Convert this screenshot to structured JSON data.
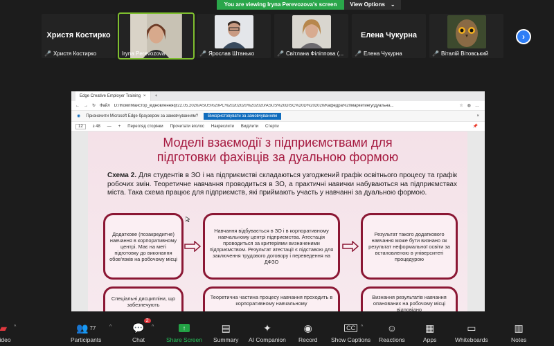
{
  "banner": {
    "message": "You are viewing Iryna Perevozova's screen",
    "options_label": "View Options",
    "options_caret": "⌄"
  },
  "gallery": [
    {
      "name_big": "Христя Костирко",
      "name": "Христя Костирко",
      "muted": true,
      "video": false
    },
    {
      "name_big": "",
      "name": "Iryna Perevozova",
      "muted": false,
      "video": true,
      "active": true
    },
    {
      "name_big": "",
      "name": "Ярослав Штанько",
      "muted": true,
      "video": true
    },
    {
      "name_big": "",
      "name": "Світлана Філіппова (...",
      "muted": true,
      "video": true
    },
    {
      "name_big": "Елена Чукурна",
      "name": "Елена Чукурна",
      "muted": true,
      "video": false
    },
    {
      "name_big": "",
      "name": "Віталій Вітовський",
      "muted": true,
      "video": true
    }
  ],
  "browser": {
    "tab_title": "Edge Creative Employer Training",
    "tab_close": "×",
    "new_tab": "+",
    "file_label": "Файл",
    "url": "D:/ІКомпМайстор_відновлення@22.05.2020/ASUS%20PC%20202020%202020/ASUS%20DISC%20D%202020/Кафедра%20маркетингу/Дуальна...",
    "notif_text": "Призначити Microsoft Edge браузером за замовчуванням?",
    "notif_button": "Використовувати за замовчуванням",
    "page_num": "12",
    "page_total": "з 48",
    "pdf_tools": [
      "Перегляд сторінки",
      "Прочитати вголос",
      "Накреслити",
      "Виділити",
      "Стерти"
    ]
  },
  "slide": {
    "title_line1": "Моделі взаємодії з підприємствами для",
    "title_line2": "підготовки фахівців за дуальною формою",
    "scheme_label": "Схема 2.",
    "scheme_text": " Для студентів в ЗО і на підприємстві складаються узгоджений графік освітнього процесу та графік робочих змін. Теоретичне навчання проводиться в ЗО, а практичні навички набуваються на підприємствах міста. Така схема працює для підприємств, які приймають участь у навчанні за дуальною формою.",
    "boxes": [
      "Додаткове (позакредитне) навчання в корпоративному центрі. Має на меті підготовку до виконання обов'язків на робочому місці",
      "Навчання відбувається в ЗО і в корпоративному навчальному центрі підприємства. Атестація проводиться за критеріями визначеними підприємством. Результат атестації є підставою для заключення трудового договору і переведення на ДФЗО",
      "Результат такого додаткового навчання може бути визнано як результат неформальної освіти за встановленою в університеті процедурою",
      "Спеціальні дисципліни, що забезпечують",
      "Теоретична частина процесу навчання проходить в корпоративному навчальному",
      "Визнання результатів навчання опанованих на робочому місці відповідно"
    ]
  },
  "toolbar": {
    "video_label": "Video",
    "participants_label": "Participants",
    "participants_count": "77",
    "chat_label": "Chat",
    "chat_badge": "2",
    "share_label": "Share Screen",
    "summary_label": "Summary",
    "ai_label": "AI Companion",
    "record_label": "Record",
    "captions_label": "Show Captions",
    "reactions_label": "Reactions",
    "apps_label": "Apps",
    "whiteboards_label": "Whiteboards",
    "notes_label": "Notes"
  },
  "colors": {
    "accent_green": "#2aa64a",
    "active_outline": "#7fbf2f",
    "slide_title": "#a5193f",
    "box_border": "#8b1734"
  }
}
